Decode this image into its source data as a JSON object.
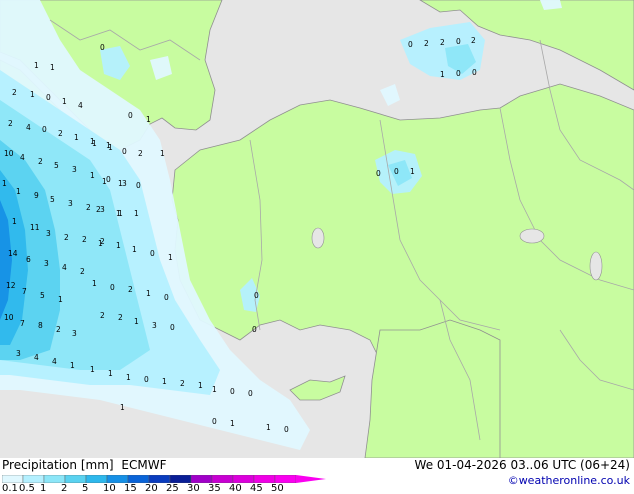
{
  "header": {
    "title": "Precipitation [mm]",
    "model": "ECMWF",
    "valid_time": "We 01-04-2026 03..06 UTC (06+24)",
    "credit": "©weatheronline.co.uk"
  },
  "legend": {
    "levels": [
      "0.1",
      "0.5",
      "1",
      "2",
      "5",
      "10",
      "15",
      "20",
      "25",
      "30",
      "35",
      "40",
      "45",
      "50"
    ],
    "colors": [
      "#e0f8ff",
      "#b4f0ff",
      "#8ce6f8",
      "#5ad2f0",
      "#2eb8ec",
      "#1690e6",
      "#0a64d8",
      "#0a3cbe",
      "#0a1e96",
      "#a000c8",
      "#c800d2",
      "#dc00dc",
      "#f000e6",
      "#fa00f0"
    ]
  },
  "colors": {
    "land": "#c8fca0",
    "sea": "#e6e6e6",
    "border": "#a8a8a8",
    "coast": "#909090"
  },
  "station_values": {
    "north_black_sea": [
      "0",
      "2",
      "2",
      "0",
      "2",
      "1",
      "0",
      "0"
    ],
    "aegean_west": [
      "0",
      "1",
      "1",
      "2",
      "1",
      "0",
      "1",
      "4",
      "2",
      "4",
      "0",
      "2",
      "1",
      "1",
      "1",
      "10",
      "4",
      "2",
      "5",
      "3",
      "1",
      "0",
      "3",
      "1",
      "1",
      "9",
      "5",
      "3",
      "2",
      "3",
      "1",
      "1",
      "11",
      "3",
      "2",
      "2",
      "1",
      "14",
      "6",
      "3",
      "4",
      "2",
      "12",
      "7",
      "5",
      "1",
      "10",
      "7",
      "8",
      "2",
      "3"
    ],
    "aegean_east": [
      "0",
      "1",
      "1",
      "1",
      "0",
      "2",
      "1",
      "1",
      "1",
      "0",
      "2",
      "1",
      "1",
      "2",
      "1",
      "1",
      "0",
      "1",
      "1",
      "0",
      "2",
      "1",
      "0",
      "2",
      "2",
      "1",
      "3",
      "0"
    ],
    "south_sea": [
      "3",
      "4",
      "4",
      "1",
      "1",
      "1",
      "1",
      "0",
      "1",
      "2",
      "1",
      "1",
      "0",
      "0",
      "1",
      "0",
      "1",
      "1",
      "0"
    ],
    "anatolia": [
      "0",
      "0",
      "1",
      "0",
      "0"
    ]
  }
}
